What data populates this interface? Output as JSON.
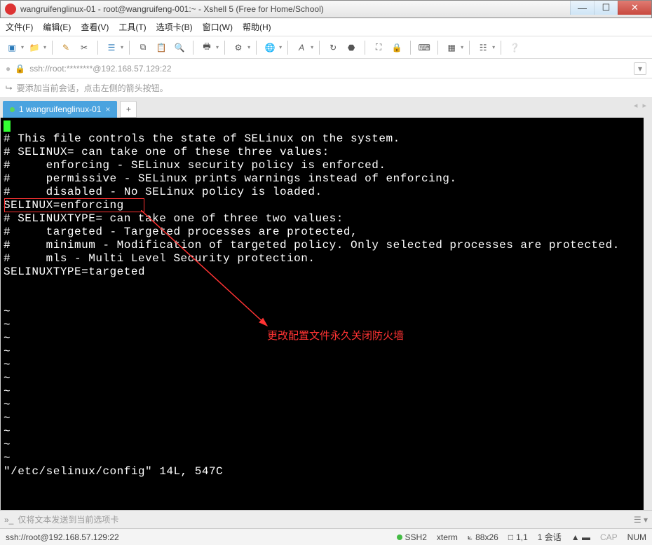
{
  "window": {
    "title": "wangruifenglinux-01 - root@wangruifeng-001:~ - Xshell 5 (Free for Home/School)"
  },
  "menu": {
    "file": "文件(F)",
    "edit": "编辑(E)",
    "view": "查看(V)",
    "tools": "工具(T)",
    "options": "选项卡(B)",
    "window": "窗口(W)",
    "help": "帮助(H)"
  },
  "address": {
    "url": "ssh://root:********@192.168.57.129:22"
  },
  "hint": {
    "text": "要添加当前会话，点击左侧的箭头按钮。"
  },
  "tab": {
    "label": "1 wangruifenglinux-01"
  },
  "terminal": {
    "lines": [
      "",
      "# This file controls the state of SELinux on the system.",
      "# SELINUX= can take one of these three values:",
      "#     enforcing - SELinux security policy is enforced.",
      "#     permissive - SELinux prints warnings instead of enforcing.",
      "#     disabled - No SELinux policy is loaded.",
      "SELINUX=enforcing",
      "# SELINUXTYPE= can take one of three two values:",
      "#     targeted - Targeted processes are protected,",
      "#     minimum - Modification of targeted policy. Only selected processes are protected.",
      "#     mls - Multi Level Security protection.",
      "SELINUXTYPE=targeted",
      "",
      "",
      "~",
      "~",
      "~",
      "~",
      "~",
      "~",
      "~",
      "~",
      "~",
      "~",
      "~",
      "~",
      "\"/etc/selinux/config\" 14L, 547C"
    ]
  },
  "annotation": {
    "text": "更改配置文件永久关闭防火墙"
  },
  "sendbar": {
    "placeholder": "仅将文本发送到当前选项卡"
  },
  "status": {
    "left": "ssh://root@192.168.57.129:22",
    "ssh": "SSH2",
    "term": "xterm",
    "size": "88x26",
    "pos": "1,1",
    "sessions": "1 会话",
    "cap": "CAP",
    "num": "NUM"
  }
}
